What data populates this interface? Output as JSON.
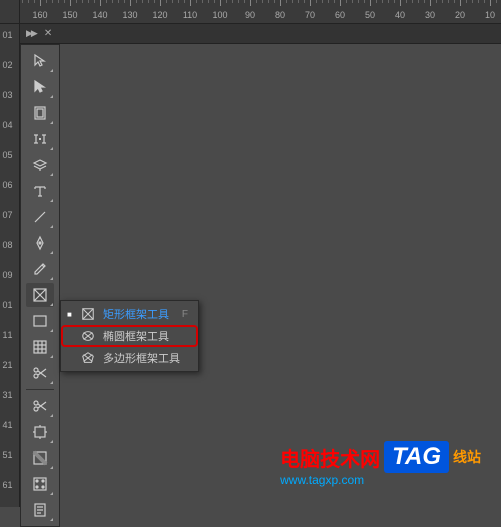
{
  "ruler_h": [
    "70",
    "160",
    "150",
    "140",
    "130",
    "120",
    "110",
    "100",
    "90",
    "80",
    "70",
    "60",
    "50",
    "40",
    "30",
    "20",
    "10"
  ],
  "ruler_v": [
    "10",
    "20",
    "30",
    "40",
    "50",
    "60",
    "70",
    "80",
    "90",
    "10",
    "11",
    "12",
    "13",
    "14",
    "15",
    "16"
  ],
  "panel": {
    "chevrons": "▶▶",
    "close": "✕"
  },
  "tools": [
    {
      "name": "selection-tool",
      "icon": "arrow"
    },
    {
      "name": "direct-selection-tool",
      "icon": "arrow-solid"
    },
    {
      "name": "page-tool",
      "icon": "page"
    },
    {
      "name": "gap-tool",
      "icon": "gap"
    },
    {
      "name": "content-collector-tool",
      "icon": "collector"
    },
    {
      "name": "type-tool",
      "icon": "type"
    },
    {
      "name": "line-tool",
      "icon": "line"
    },
    {
      "name": "pen-tool",
      "icon": "pen"
    },
    {
      "name": "pencil-tool",
      "icon": "pencil"
    },
    {
      "name": "rectangle-frame-tool",
      "icon": "frame-x",
      "active": true
    },
    {
      "name": "rectangle-tool",
      "icon": "rect"
    },
    {
      "name": "grid-tool",
      "icon": "grid"
    },
    {
      "name": "scissors-tool",
      "icon": "scissors"
    }
  ],
  "tools2": [
    {
      "name": "scissors-tool-2",
      "icon": "scissors2"
    },
    {
      "name": "free-transform-tool",
      "icon": "transform"
    },
    {
      "name": "gradient-swatch-tool",
      "icon": "gradient-swatch"
    },
    {
      "name": "gradient-feather-tool",
      "icon": "feather"
    },
    {
      "name": "note-tool",
      "icon": "note"
    }
  ],
  "flyout": {
    "items": [
      {
        "current": true,
        "label": "矩形框架工具",
        "shortcut": "F",
        "name": "rectangle-frame-tool-option"
      },
      {
        "highlighted": true,
        "label": "椭圆框架工具",
        "shortcut": "",
        "name": "ellipse-frame-tool-option"
      },
      {
        "label": "多边形框架工具",
        "shortcut": "",
        "name": "polygon-frame-tool-option"
      }
    ]
  },
  "watermark": {
    "title": "电脑技术网",
    "tag": "TAG",
    "suffix": "线站",
    "url": "www.tagxp.com",
    "url2": ".com"
  }
}
